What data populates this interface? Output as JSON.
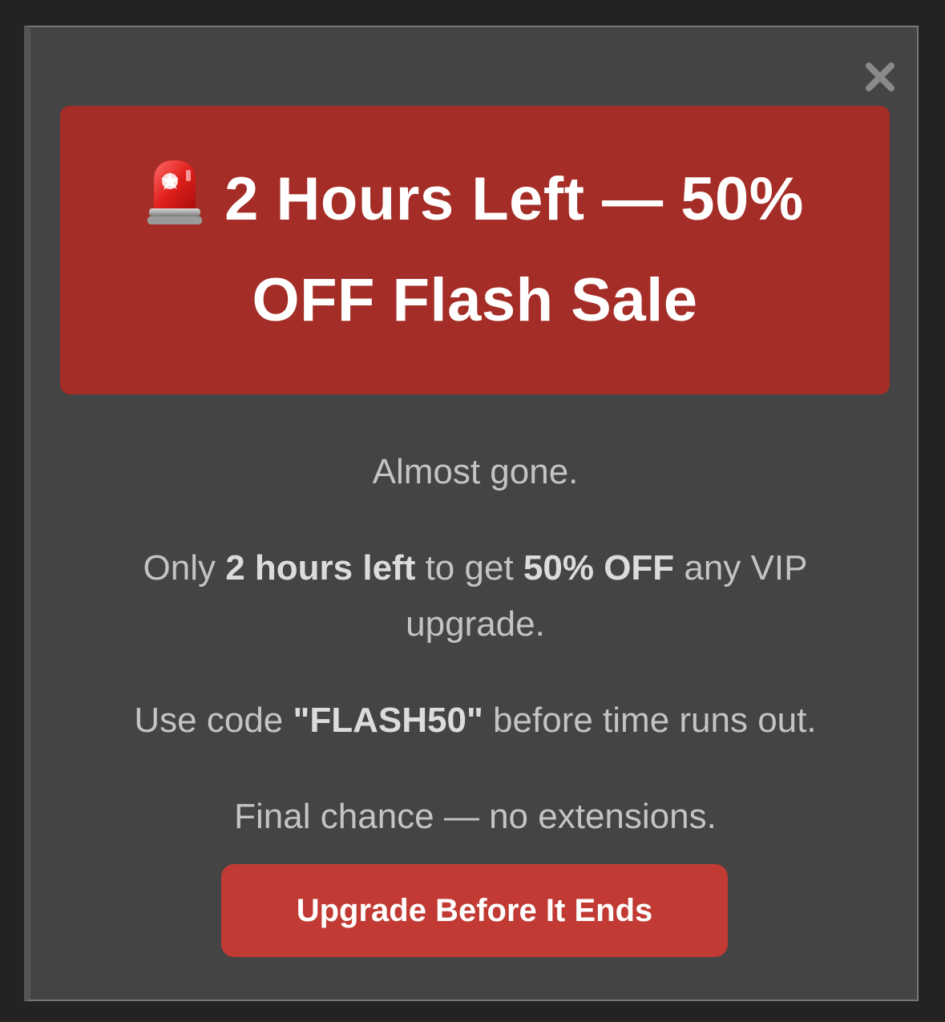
{
  "modal": {
    "close_icon": "close-icon",
    "banner": {
      "icon": "siren-icon",
      "title": "2 Hours Left — 50% OFF Flash Sale"
    },
    "paragraphs": {
      "p1": "Almost gone.",
      "p2": {
        "t1": "Only ",
        "b1": "2 hours left",
        "t2": " to get ",
        "b2": "50% OFF",
        "t3": " any VIP upgrade."
      },
      "p3": {
        "t1": "Use code ",
        "b1": "\"FLASH50\"",
        "t2": " before time runs out."
      },
      "p4": "Final chance — no extensions."
    },
    "cta_label": "Upgrade Before It Ends"
  },
  "colors": {
    "backdrop": "#232323",
    "modal_bg": "#444444",
    "banner_bg": "#a52d27",
    "cta_bg": "#c13b34",
    "body_text": "#c4c4c4"
  }
}
